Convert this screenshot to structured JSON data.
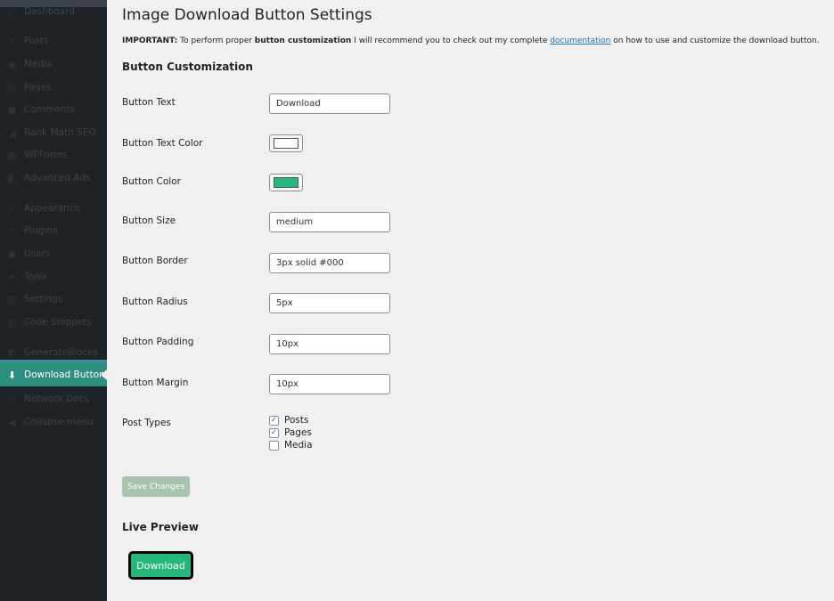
{
  "sidebar": {
    "items": [
      {
        "label": "Dashboard",
        "icon": "dashboard-icon",
        "glyph": "◴"
      },
      {
        "label": "Posts",
        "icon": "pin-icon",
        "glyph": "✎"
      },
      {
        "label": "Media",
        "icon": "media-icon",
        "glyph": "▣"
      },
      {
        "label": "Pages",
        "icon": "pages-icon",
        "glyph": "▤"
      },
      {
        "label": "Comments",
        "icon": "comments-icon",
        "glyph": "◼"
      },
      {
        "label": "Rank Math SEO",
        "icon": "chart-icon",
        "glyph": "◢"
      },
      {
        "label": "WPForms",
        "icon": "forms-icon",
        "glyph": "▦"
      },
      {
        "label": "Advanced Ads",
        "icon": "ads-icon",
        "glyph": "◧"
      },
      {
        "label": "Appearance",
        "icon": "brush-icon",
        "glyph": "✐"
      },
      {
        "label": "Plugins",
        "icon": "plug-icon",
        "glyph": "⚡"
      },
      {
        "label": "Users",
        "icon": "users-icon",
        "glyph": "●"
      },
      {
        "label": "Tools",
        "icon": "wrench-icon",
        "glyph": "✦"
      },
      {
        "label": "Settings",
        "icon": "settings-icon",
        "glyph": "▥"
      },
      {
        "label": "Code Snippets",
        "icon": "code-icon",
        "glyph": "▨"
      },
      {
        "label": "GenerateBlocks",
        "icon": "blocks-icon",
        "glyph": "◩"
      },
      {
        "label": "Download Button",
        "icon": "download-icon",
        "glyph": "⬇"
      },
      {
        "label": "Network Docs",
        "icon": "network-icon",
        "glyph": "◎"
      },
      {
        "label": "Collapse menu",
        "icon": "collapse-icon",
        "glyph": "◀"
      }
    ]
  },
  "page": {
    "title": "Image Download Button Settings",
    "notice_important": "IMPORTANT:",
    "notice_text1": " To perform proper ",
    "notice_bold": "button customization",
    "notice_text2": " I will recommend you to check out my complete ",
    "notice_link": "documentation",
    "notice_text3": " on how to use and customize the download button.",
    "section_customization": "Button Customization",
    "section_preview": "Live Preview"
  },
  "fields": {
    "button_text": {
      "label": "Button Text",
      "value": "Download"
    },
    "text_color": {
      "label": "Button Text Color",
      "value": "#ffffff"
    },
    "button_color": {
      "label": "Button Color",
      "value": "#26b77a"
    },
    "button_size": {
      "label": "Button Size",
      "value": "medium"
    },
    "button_border": {
      "label": "Button Border",
      "value": "3px solid #000"
    },
    "button_radius": {
      "label": "Button Radius",
      "value": "5px"
    },
    "button_padding": {
      "label": "Button Padding",
      "value": "10px"
    },
    "button_margin": {
      "label": "Button Margin",
      "value": "10px"
    },
    "post_types": {
      "label": "Post Types",
      "options": [
        {
          "label": "Posts",
          "checked": true
        },
        {
          "label": "Pages",
          "checked": true
        },
        {
          "label": "Media",
          "checked": false
        }
      ]
    }
  },
  "actions": {
    "save_label": "Save Changes"
  },
  "preview": {
    "label": "Download"
  },
  "colors": {
    "preview_button": "#26b77a",
    "active_menu": "#2d8f7f",
    "link": "#2271b1"
  }
}
